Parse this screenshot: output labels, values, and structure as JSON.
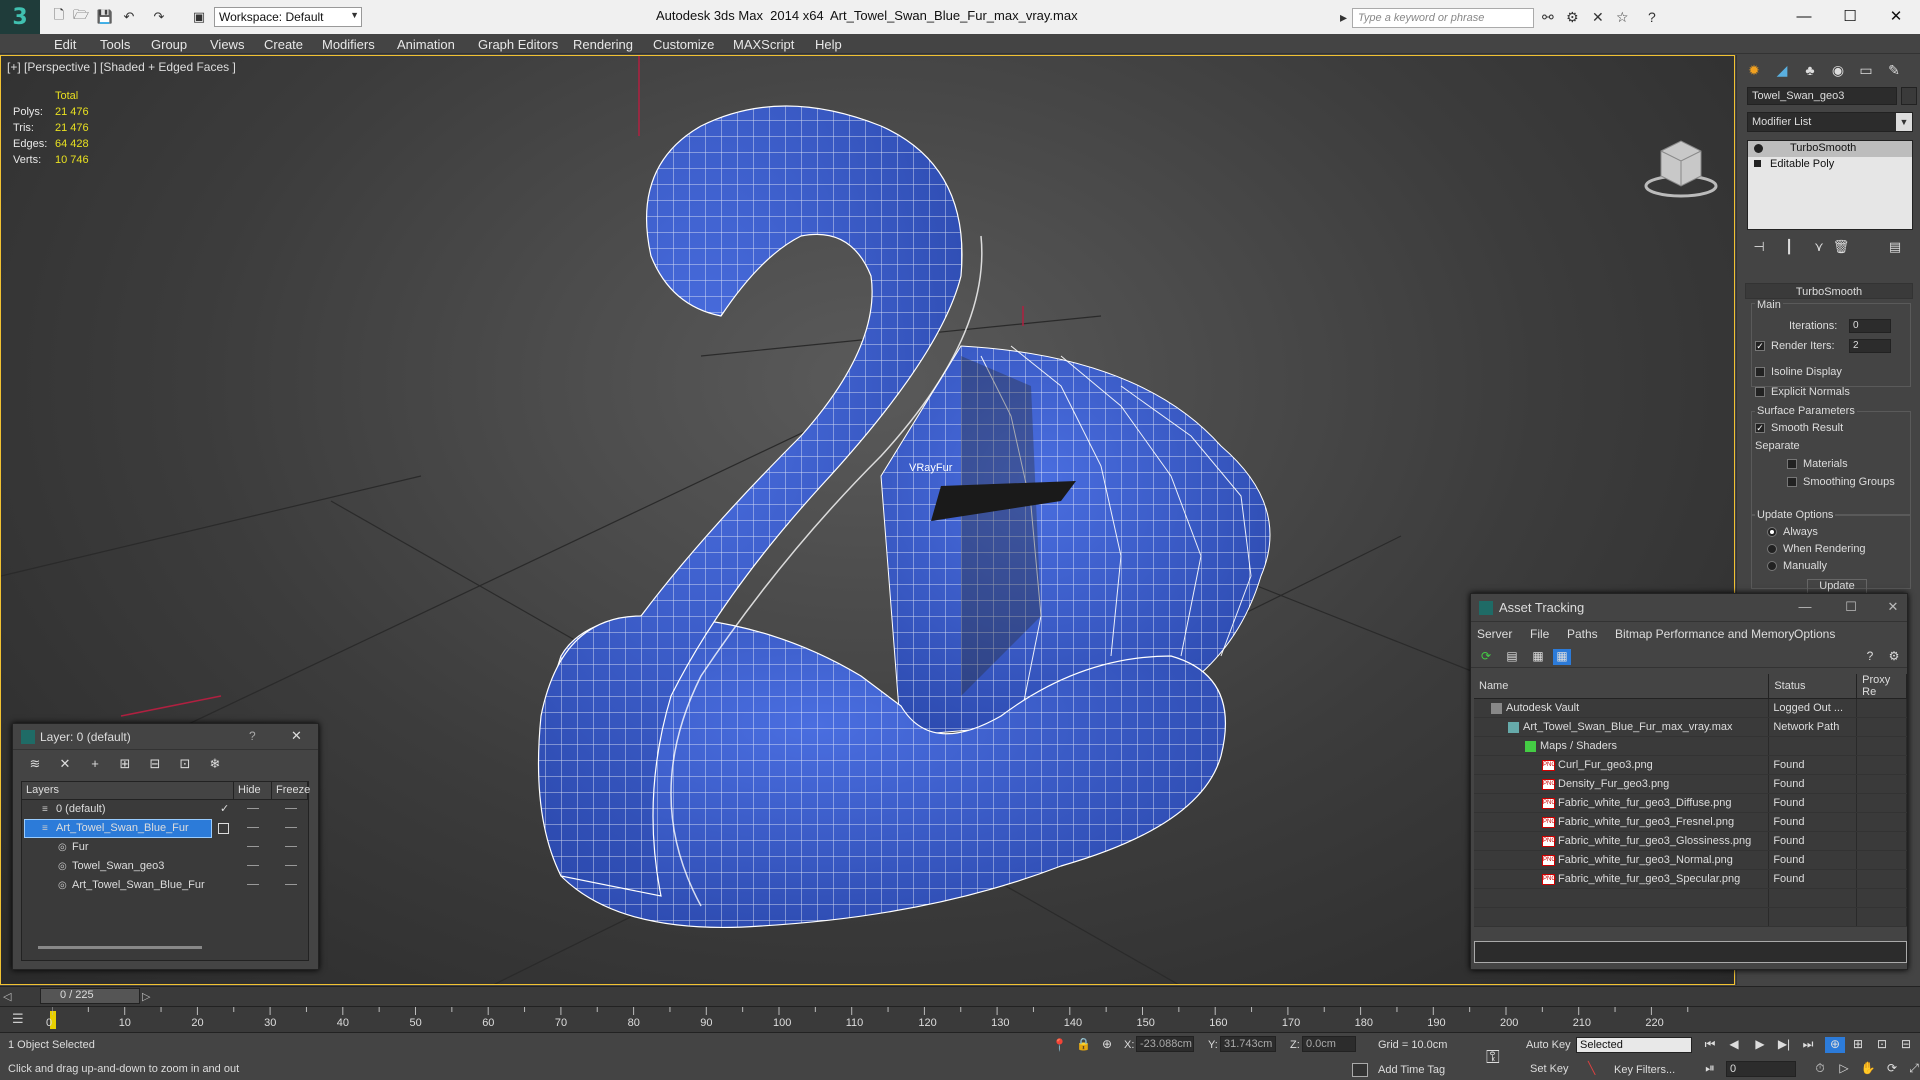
{
  "title_bar": {
    "workspace_label": "Workspace: Default",
    "app_title": "Autodesk 3ds Max  2014 x64",
    "file_title": "Art_Towel_Swan_Blue_Fur_max_vray.max",
    "search_placeholder": "Type a keyword or phrase"
  },
  "menu": [
    "Edit",
    "Tools",
    "Group",
    "Views",
    "Create",
    "Modifiers",
    "Animation",
    "Graph Editors",
    "Rendering",
    "Customize",
    "MAXScript",
    "Help"
  ],
  "viewport": {
    "label": "[+] [Perspective ] [Shaded + Edged Faces ]",
    "stats": {
      "header": "Total",
      "rows": [
        {
          "k": "Polys:",
          "v": "21 476"
        },
        {
          "k": "Tris:",
          "v": "21 476"
        },
        {
          "k": "Edges:",
          "v": "64 428"
        },
        {
          "k": "Verts:",
          "v": "10 746"
        }
      ]
    },
    "object_label": "VRayFur"
  },
  "command_panel": {
    "object_name": "Towel_Swan_geo3",
    "modifier_list": "Modifier List",
    "stack": [
      "TurboSmooth",
      "Editable Poly"
    ],
    "rollout_title": "TurboSmooth",
    "main_label": "Main",
    "iterations_label": "Iterations:",
    "iterations_value": "0",
    "render_iters_label": "Render Iters:",
    "render_iters_value": "2",
    "isoline_label": "Isoline Display",
    "explicit_normals_label": "Explicit Normals",
    "surface_params_label": "Surface Parameters",
    "smooth_result_label": "Smooth Result",
    "separate_label": "Separate",
    "materials_label": "Materials",
    "smoothing_groups_label": "Smoothing Groups",
    "update_options_label": "Update Options",
    "always_label": "Always",
    "when_rendering_label": "When Rendering",
    "manually_label": "Manually",
    "update_button": "Update"
  },
  "asset_tracking": {
    "title": "Asset Tracking",
    "menu": [
      "Server",
      "File",
      "Paths",
      "Bitmap Performance and Memory",
      "Options"
    ],
    "columns": [
      "Name",
      "Status",
      "Proxy Re"
    ],
    "rows": [
      {
        "name": "Autodesk Vault",
        "status": "Logged Out ...",
        "indent": 1,
        "kind": "vault"
      },
      {
        "name": "Art_Towel_Swan_Blue_Fur_max_vray.max",
        "status": "Network Path",
        "indent": 2,
        "kind": "max"
      },
      {
        "name": "Maps / Shaders",
        "status": "",
        "indent": 3,
        "kind": "maps"
      },
      {
        "name": "Curl_Fur_geo3.png",
        "status": "Found",
        "indent": 4,
        "kind": "png"
      },
      {
        "name": "Density_Fur_geo3.png",
        "status": "Found",
        "indent": 4,
        "kind": "png"
      },
      {
        "name": "Fabric_white_fur_geo3_Diffuse.png",
        "status": "Found",
        "indent": 4,
        "kind": "png"
      },
      {
        "name": "Fabric_white_fur_geo3_Fresnel.png",
        "status": "Found",
        "indent": 4,
        "kind": "png"
      },
      {
        "name": "Fabric_white_fur_geo3_Glossiness.png",
        "status": "Found",
        "indent": 4,
        "kind": "png"
      },
      {
        "name": "Fabric_white_fur_geo3_Normal.png",
        "status": "Found",
        "indent": 4,
        "kind": "png"
      },
      {
        "name": "Fabric_white_fur_geo3_Specular.png",
        "status": "Found",
        "indent": 4,
        "kind": "png"
      }
    ]
  },
  "layer_dialog": {
    "title": "Layer: 0 (default)",
    "columns": [
      "Layers",
      "Hide",
      "Freeze"
    ],
    "rows": [
      {
        "name": "0 (default)",
        "indent": 1,
        "sel": false,
        "check": true
      },
      {
        "name": "Art_Towel_Swan_Blue_Fur",
        "indent": 1,
        "sel": true,
        "check": false
      },
      {
        "name": "Fur",
        "indent": 2,
        "sel": false,
        "check": false
      },
      {
        "name": "Towel_Swan_geo3",
        "indent": 2,
        "sel": false,
        "check": false
      },
      {
        "name": "Art_Towel_Swan_Blue_Fur",
        "indent": 2,
        "sel": false,
        "check": false
      }
    ]
  },
  "time_slider": {
    "value": "0 / 225"
  },
  "ruler_ticks": [
    "0",
    "10",
    "20",
    "30",
    "40",
    "50",
    "60",
    "70",
    "80",
    "90",
    "100",
    "110",
    "120",
    "130",
    "140",
    "150",
    "160",
    "170",
    "180",
    "190",
    "200",
    "210",
    "220"
  ],
  "status_bar": {
    "selection": "1 Object Selected",
    "prompt": "Click and drag up-and-down to zoom in and out",
    "x_label": "X:",
    "x_value": "-23.088cm",
    "y_label": "Y:",
    "y_value": "31.743cm",
    "z_label": "Z:",
    "z_value": "0.0cm",
    "grid": "Grid = 10.0cm",
    "add_time_tag": "Add Time Tag",
    "auto_key": "Auto Key",
    "set_key": "Set Key",
    "key_mode": "Selected",
    "key_filters": "Key Filters...",
    "frame": "0"
  },
  "colors": {
    "accent": "#f1c232",
    "mesh": "#3b5fd0",
    "stats": "#e8e020",
    "selection": "#2c7bd9"
  }
}
